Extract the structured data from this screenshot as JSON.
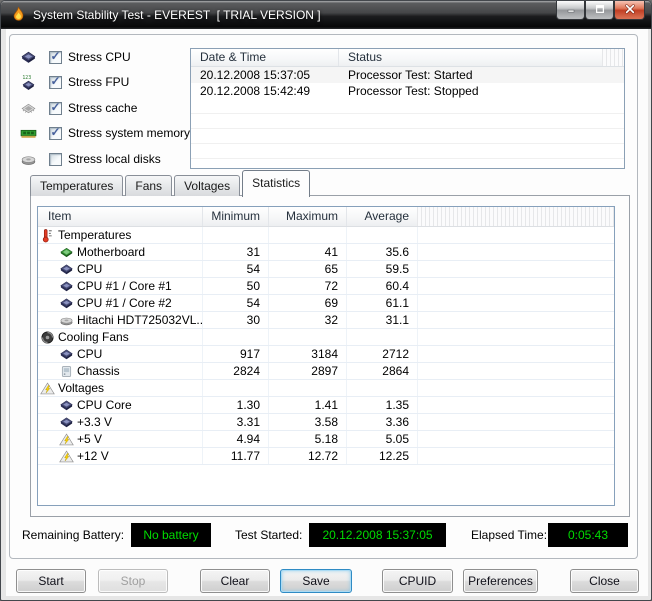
{
  "window": {
    "title": "System Stability Test - EVEREST  [ TRIAL VERSION ]",
    "app_icon": "flame-icon",
    "controls": {
      "minimize": "minimize-icon",
      "maximize": "maximize-icon",
      "close": "close-icon"
    }
  },
  "colors": {
    "value_green": "#00dc00",
    "value_bg": "#000000",
    "focus_blue": "#2f8bc4",
    "close_red": "#c13f24",
    "list_border": "#8ba0b5",
    "table_border": "#86a0bb"
  },
  "stress_options": [
    {
      "icon": "cpu-icon",
      "label": "Stress CPU",
      "state": "checked"
    },
    {
      "icon": "fpu-icon",
      "label": "Stress FPU",
      "state": "checked"
    },
    {
      "icon": "cache-icon",
      "label": "Stress cache",
      "state": "checked"
    },
    {
      "icon": "memory-icon",
      "label": "Stress system memory",
      "state": "checked"
    },
    {
      "icon": "disk-icon",
      "label": "Stress local disks",
      "state": "unchecked"
    }
  ],
  "event_log": {
    "columns": {
      "date": "Date & Time",
      "status": "Status"
    },
    "rows": [
      {
        "date": "20.12.2008 15:37:05",
        "status": "Processor Test: Started"
      },
      {
        "date": "20.12.2008 15:42:49",
        "status": "Processor Test: Stopped"
      }
    ]
  },
  "tabs": [
    {
      "label": "Temperatures",
      "state": "inactive"
    },
    {
      "label": "Fans",
      "state": "inactive"
    },
    {
      "label": "Voltages",
      "state": "inactive"
    },
    {
      "label": "Statistics",
      "state": "active"
    }
  ],
  "statistics_table": {
    "columns": {
      "item": "Item",
      "min": "Minimum",
      "max": "Maximum",
      "avg": "Average"
    },
    "rows": [
      {
        "state": "group",
        "icon": "thermometer-icon",
        "label": "Temperatures",
        "min": "",
        "max": "",
        "avg": ""
      },
      {
        "state": "item",
        "icon": "motherboard-icon",
        "label": "Motherboard",
        "min": "31",
        "max": "41",
        "avg": "35.6"
      },
      {
        "state": "item",
        "icon": "cpu-icon",
        "label": "CPU",
        "min": "54",
        "max": "65",
        "avg": "59.5"
      },
      {
        "state": "item",
        "icon": "cpu-icon",
        "label": "CPU #1 / Core #1",
        "min": "50",
        "max": "72",
        "avg": "60.4"
      },
      {
        "state": "item",
        "icon": "cpu-icon",
        "label": "CPU #1 / Core #2",
        "min": "54",
        "max": "69",
        "avg": "61.1"
      },
      {
        "state": "item",
        "icon": "disk-icon",
        "label": "Hitachi HDT725032VL...",
        "min": "30",
        "max": "32",
        "avg": "31.1"
      },
      {
        "state": "group",
        "icon": "fan-icon",
        "label": "Cooling Fans",
        "min": "",
        "max": "",
        "avg": ""
      },
      {
        "state": "item",
        "icon": "cpu-icon",
        "label": "CPU",
        "min": "917",
        "max": "3184",
        "avg": "2712"
      },
      {
        "state": "item",
        "icon": "chassis-icon",
        "label": "Chassis",
        "min": "2824",
        "max": "2897",
        "avg": "2864"
      },
      {
        "state": "group",
        "icon": "voltage-icon",
        "label": "Voltages",
        "min": "",
        "max": "",
        "avg": ""
      },
      {
        "state": "item",
        "icon": "cpu-icon",
        "label": "CPU Core",
        "min": "1.30",
        "max": "1.41",
        "avg": "1.35"
      },
      {
        "state": "item",
        "icon": "cpu-icon",
        "label": "+3.3 V",
        "min": "3.31",
        "max": "3.58",
        "avg": "3.36"
      },
      {
        "state": "item",
        "icon": "voltage-icon",
        "label": "+5 V",
        "min": "4.94",
        "max": "5.18",
        "avg": "5.05"
      },
      {
        "state": "item",
        "icon": "voltage-icon",
        "label": "+12 V",
        "min": "11.77",
        "max": "12.72",
        "avg": "12.25"
      }
    ]
  },
  "status_bar": {
    "battery_label": "Remaining Battery:",
    "battery_value": "No battery",
    "started_label": "Test Started:",
    "started_value": "20.12.2008 15:37:05",
    "elapsed_label": "Elapsed Time:",
    "elapsed_value": "0:05:43"
  },
  "buttons": [
    {
      "label": "Start",
      "state": "normal"
    },
    {
      "label": "Stop",
      "state": "disabled"
    },
    {
      "label": "Clear",
      "state": "normal"
    },
    {
      "label": "Save",
      "state": "focused"
    },
    {
      "label": "CPUID",
      "state": "normal"
    },
    {
      "label": "Preferences",
      "state": "normal"
    },
    {
      "label": "Close",
      "state": "normal"
    }
  ]
}
